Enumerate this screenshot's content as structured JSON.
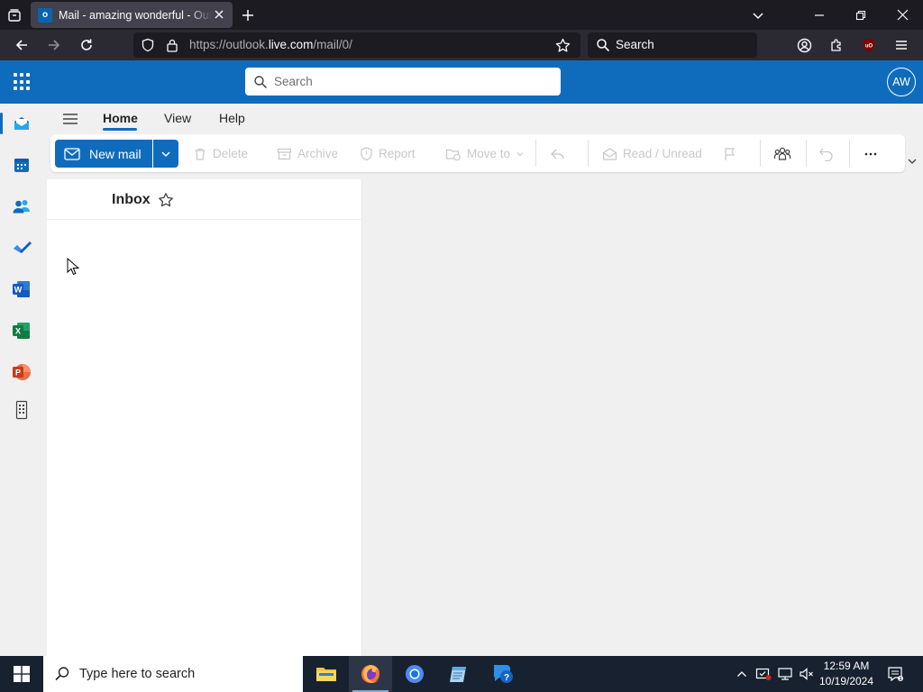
{
  "browser": {
    "tab_title": "Mail - amazing wonderful - Outlook",
    "url_prefix": "https://outlook.",
    "url_host": "live.com",
    "url_path": "/mail/0/",
    "search_label": "Search"
  },
  "outlook": {
    "search_placeholder": "Search",
    "avatar_initials": "AW",
    "ribbon_tabs": [
      "Home",
      "View",
      "Help"
    ],
    "toolbar": {
      "new_mail": "New mail",
      "delete": "Delete",
      "archive": "Archive",
      "report": "Report",
      "move_to": "Move to",
      "read_unread": "Read / Unread"
    },
    "folder_title": "Inbox"
  },
  "taskbar": {
    "search_placeholder": "Type here to search",
    "time": "12:59 AM",
    "date": "10/19/2024"
  },
  "colors": {
    "brand": "#0f6cbd",
    "browser_bg": "#1c1b22",
    "taskbar_bg": "#18212f"
  }
}
